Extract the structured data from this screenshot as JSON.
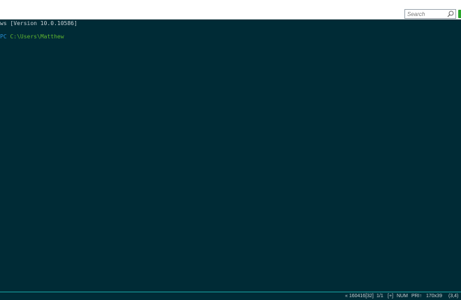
{
  "toolbar": {
    "search_placeholder": "Search"
  },
  "console": {
    "line1": "ws [Version 10.0.10586]",
    "prompt_host": "PC",
    "prompt_path": "C:\\Users\\Matthew"
  },
  "statusbar": {
    "position_info": "« 160416[32]",
    "tab_index": "1/1",
    "mode_indicator": "[+]",
    "num_lock": "NUM",
    "priority": "PRI↑",
    "console_size": "170x39",
    "cursor_pos": "(3,4)"
  },
  "colors": {
    "console_bg": "#002b36",
    "host_text": "#268bd2",
    "path_text": "#5fb52f",
    "status_border": "#19a3a3",
    "green_button": "#2aa52a"
  }
}
